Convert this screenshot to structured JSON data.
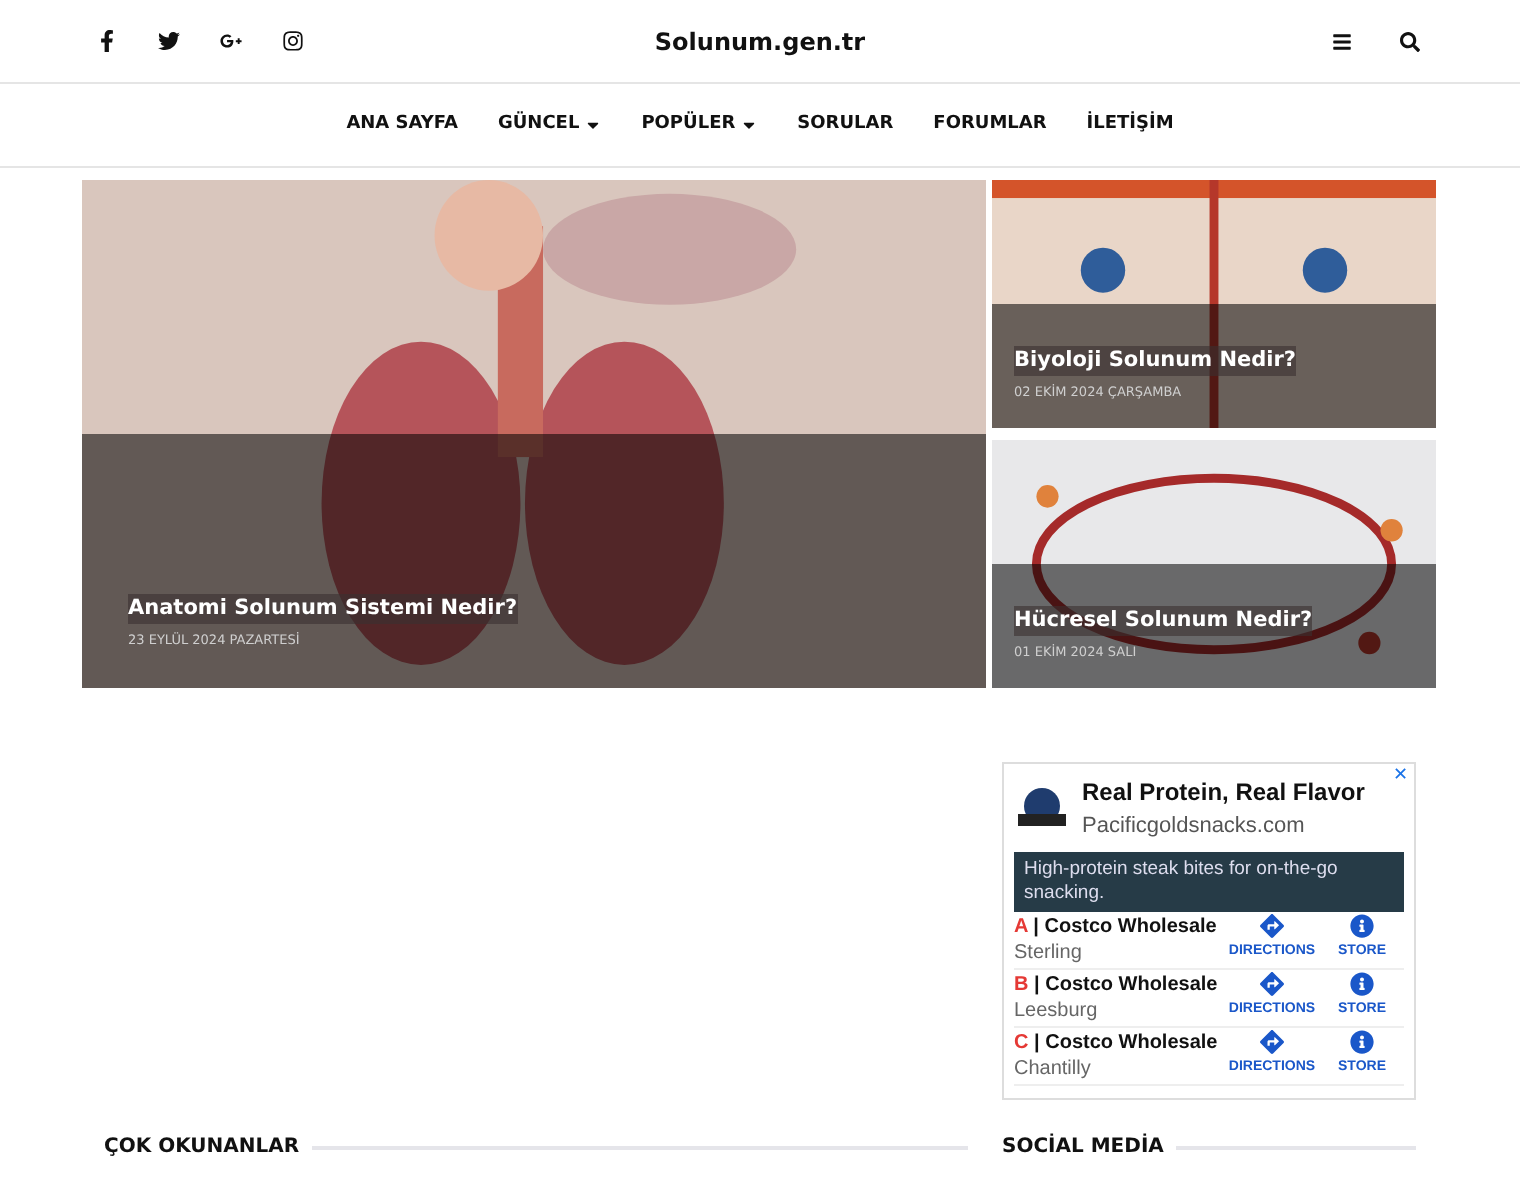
{
  "site_title": "Solunum.gen.tr",
  "nav": [
    {
      "label": "ANA SAYFA",
      "dropdown": false
    },
    {
      "label": "GÜNCEL",
      "dropdown": true
    },
    {
      "label": "POPÜLER",
      "dropdown": true
    },
    {
      "label": "SORULAR",
      "dropdown": false
    },
    {
      "label": "FORUMLAR",
      "dropdown": false
    },
    {
      "label": "İLETİŞİM",
      "dropdown": false
    }
  ],
  "featured": [
    {
      "title": "Anatomi Solunum Sistemi Nedir?",
      "date": "23 EYLÜL 2024 PAZARTESİ"
    },
    {
      "title": "Biyoloji Solunum Nedir?",
      "date": "02 EKİM 2024 ÇARŞAMBA"
    },
    {
      "title": "Hücresel Solunum Nedir?",
      "date": "01 EKİM 2024 SALI"
    }
  ],
  "ad": {
    "close": "✕",
    "headline": "Real Protein, Real Flavor",
    "domain": "Pacificgoldsnacks.com",
    "description": "High-protein steak bites for on-the-go snacking.",
    "locations": [
      {
        "letter": "A",
        "separator": "|",
        "name": "Costco Wholesale",
        "city": "Sterling",
        "directions": "DIRECTIONS",
        "store": "STORE"
      },
      {
        "letter": "B",
        "separator": "|",
        "name": "Costco Wholesale",
        "city": "Leesburg",
        "directions": "DIRECTIONS",
        "store": "STORE"
      },
      {
        "letter": "C",
        "separator": "|",
        "name": "Costco Wholesale",
        "city": "Chantilly",
        "directions": "DIRECTIONS",
        "store": "STORE"
      }
    ]
  },
  "sections": [
    {
      "title": "ÇOK OKUNANLAR"
    },
    {
      "title": "SOCİAL MEDİA"
    }
  ]
}
